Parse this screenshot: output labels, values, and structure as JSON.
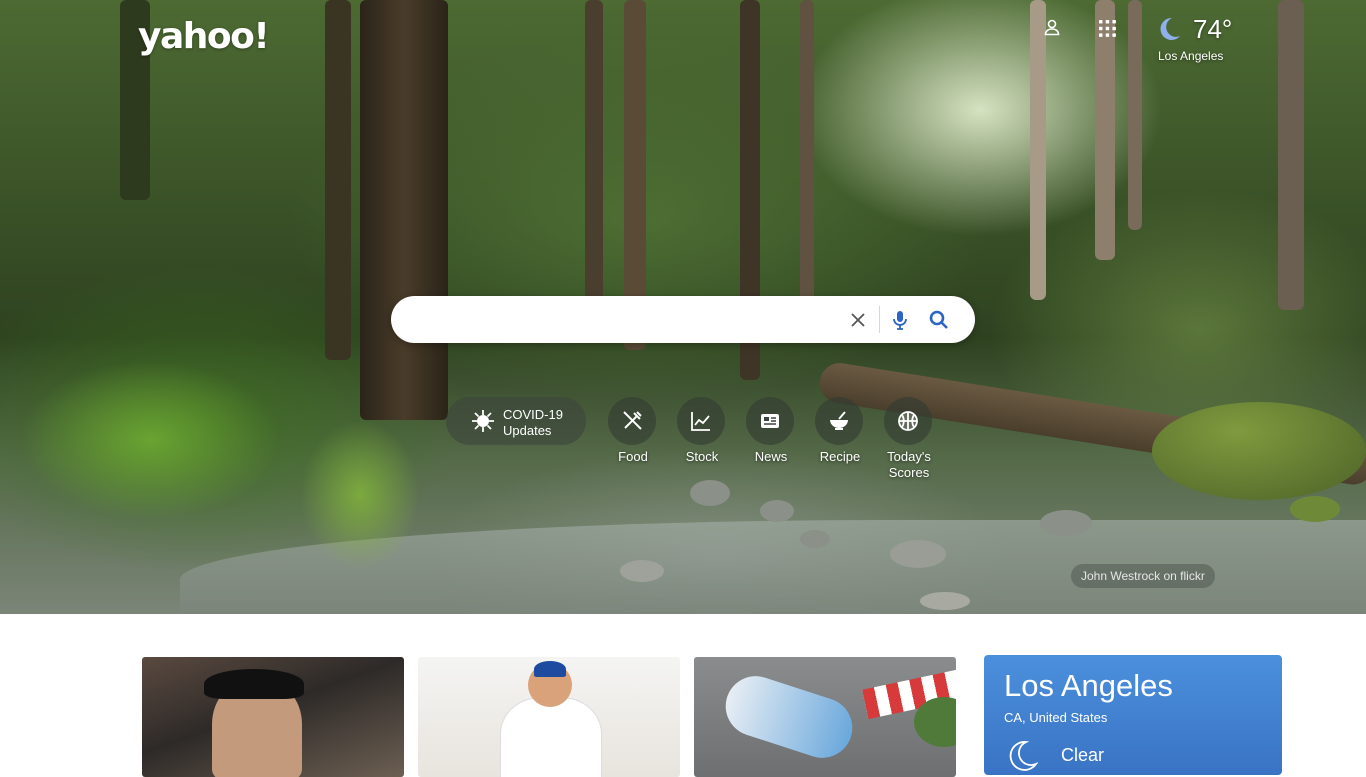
{
  "header": {
    "logo_text": "yahoo!",
    "profile_icon": "user-icon",
    "apps_icon": "grid-icon",
    "weather": {
      "icon": "moon-icon",
      "temperature": "74°",
      "city": "Los Angeles"
    }
  },
  "search": {
    "placeholder": "",
    "value": "",
    "clear_icon": "close-icon",
    "voice_icon": "microphone-icon",
    "search_icon": "search-icon"
  },
  "shortcuts": [
    {
      "line1": "COVID-19",
      "line2": "Updates",
      "icon": "virus-icon"
    },
    {
      "label": "Food",
      "icon": "fork-knife-icon"
    },
    {
      "label": "Stock",
      "icon": "chart-icon"
    },
    {
      "label": "News",
      "icon": "newspaper-icon"
    },
    {
      "label": "Recipe",
      "icon": "bowl-icon"
    },
    {
      "line1": "Today's",
      "line2": "Scores",
      "icon": "basketball-icon"
    }
  ],
  "photo_credit": "John Westrock on flickr",
  "weather_card": {
    "city": "Los Angeles",
    "region": "CA, United States",
    "condition": "Clear",
    "icon": "moon-icon"
  },
  "colors": {
    "weather_card_top": "#4b90dd",
    "weather_card_bottom": "#3a73c4",
    "search_icon": "#2c64c6",
    "pill_background": "rgba(60,70,60,0.62)"
  }
}
